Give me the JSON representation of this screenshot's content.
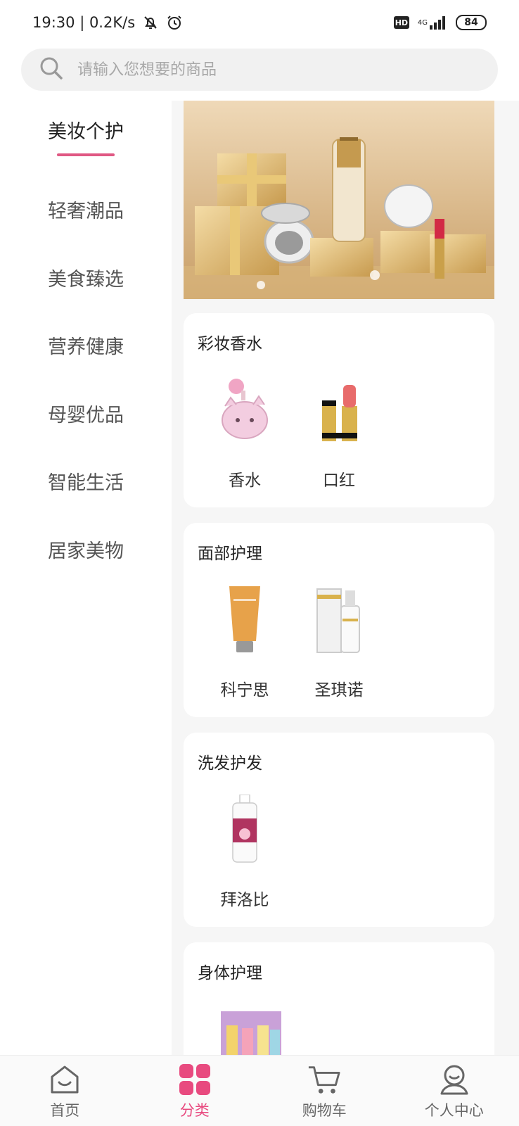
{
  "status": {
    "time_speed": "19:30 | 0.2K/s",
    "hd": "HD",
    "network": "4G",
    "battery": "84"
  },
  "search": {
    "placeholder": "请输入您想要的商品"
  },
  "sidebar": {
    "items": [
      {
        "label": "美妆个护",
        "active": true
      },
      {
        "label": "轻奢潮品",
        "active": false
      },
      {
        "label": "美食臻选",
        "active": false
      },
      {
        "label": "营养健康",
        "active": false
      },
      {
        "label": "母婴优品",
        "active": false
      },
      {
        "label": "智能生活",
        "active": false
      },
      {
        "label": "居家美物",
        "active": false
      }
    ]
  },
  "sections": [
    {
      "title": "彩妆香水",
      "products": [
        {
          "name": "香水",
          "icon": "perfume-icon"
        },
        {
          "name": "口红",
          "icon": "lipstick-icon"
        }
      ]
    },
    {
      "title": "面部护理",
      "products": [
        {
          "name": "科宁思",
          "icon": "cream-tube-icon"
        },
        {
          "name": "圣琪诺",
          "icon": "foam-bottle-icon"
        }
      ]
    },
    {
      "title": "洗发护发",
      "products": [
        {
          "name": "拜洛比",
          "icon": "shampoo-bottle-icon"
        }
      ]
    },
    {
      "title": "身体护理",
      "products": []
    }
  ],
  "tabbar": {
    "items": [
      {
        "label": "首页",
        "icon": "home-icon",
        "active": false
      },
      {
        "label": "分类",
        "icon": "category-icon",
        "active": true
      },
      {
        "label": "购物车",
        "icon": "cart-icon",
        "active": false
      },
      {
        "label": "个人中心",
        "icon": "user-icon",
        "active": false
      }
    ]
  },
  "colors": {
    "accent": "#e84a7f",
    "underline": "#e05883",
    "content_bg": "#f6f6f6"
  }
}
